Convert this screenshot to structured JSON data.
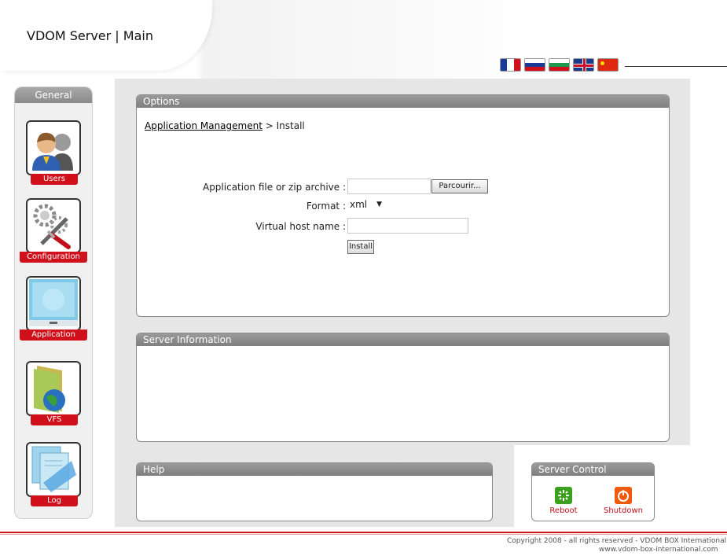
{
  "header": {
    "title": "VDOM Server | Main"
  },
  "languages": [
    "French",
    "Russian",
    "Bulgarian",
    "English",
    "Chinese"
  ],
  "sidebar": {
    "title": "General",
    "items": [
      {
        "label": "Users",
        "icon": "users-icon"
      },
      {
        "label": "Configuration",
        "icon": "gears-wrench-icon"
      },
      {
        "label": "Application",
        "icon": "monitor-icon"
      },
      {
        "label": "VFS",
        "icon": "folder-globe-icon"
      },
      {
        "label": "Log",
        "icon": "documents-icon"
      }
    ]
  },
  "options": {
    "title": "Options",
    "breadcrumb": {
      "link": "Application Management",
      "separator": " > ",
      "current": "Install"
    },
    "form": {
      "file_label": "Application file or zip archive :",
      "file_value": "",
      "browse_label": "Parcourir...",
      "format_label": "Format :",
      "format_value": "xml",
      "vhost_label": "Virtual host name :",
      "vhost_value": "",
      "install_label": "Install"
    }
  },
  "server_info": {
    "title": "Server Information"
  },
  "help": {
    "title": "Help"
  },
  "server_control": {
    "title": "Server Control",
    "reboot_label": "Reboot",
    "shutdown_label": "Shutdown"
  },
  "footer": {
    "copyright": "Copyright 2008 - all rights reserved - VDOM BOX International",
    "url": "www.vdom-box-international.com"
  },
  "colors": {
    "accent_red": "#d0101a",
    "panel_header": "#8a8a8a",
    "reboot_green": "#3aa01e",
    "shutdown_orange": "#f05a0a"
  }
}
